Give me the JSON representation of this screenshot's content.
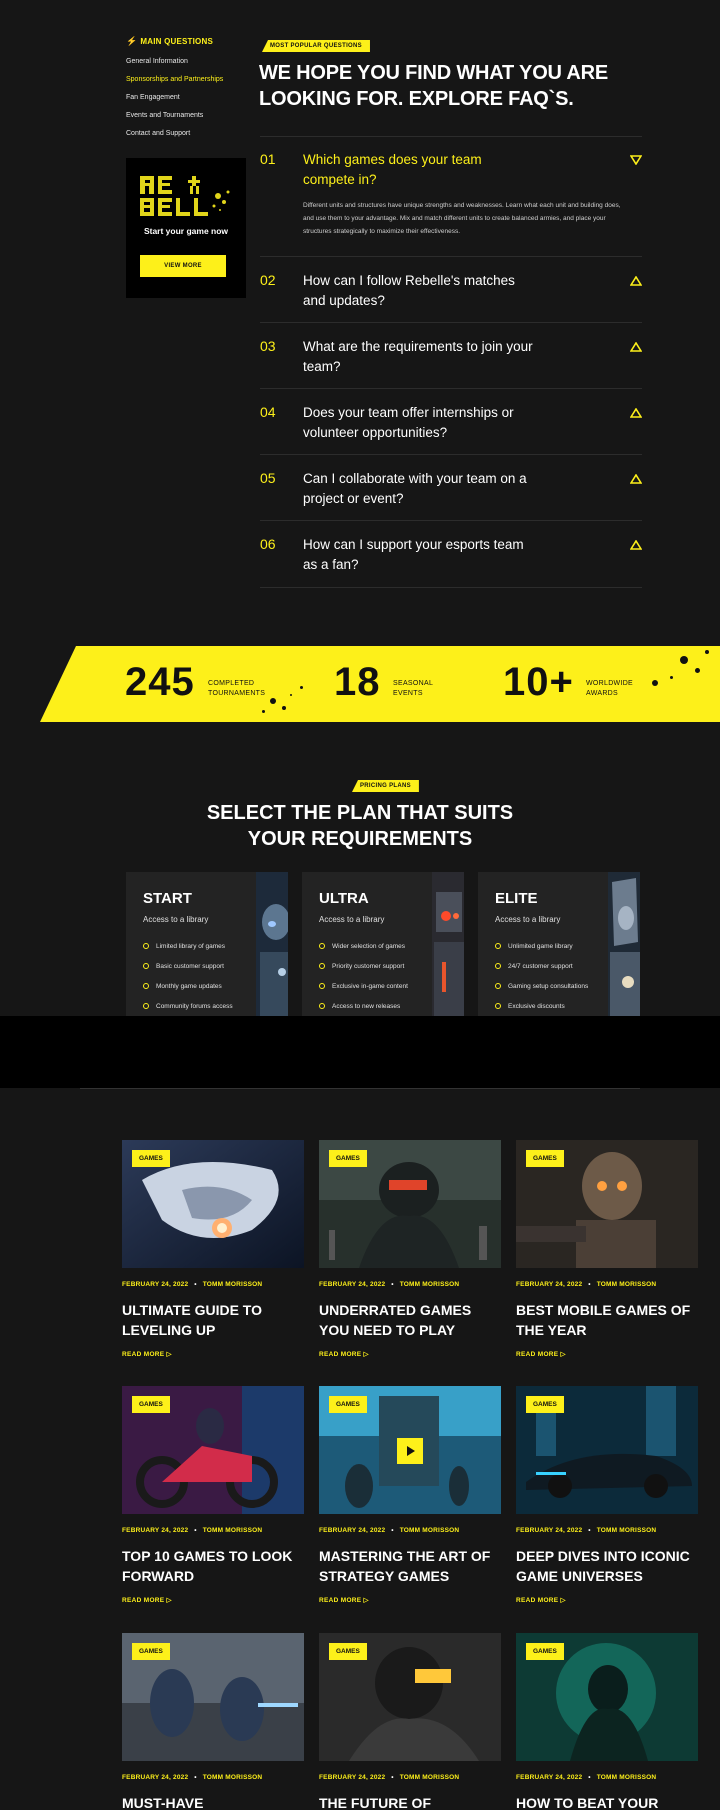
{
  "faq_nav": {
    "title": "MAIN QUESTIONS",
    "items": [
      {
        "label": "General Information",
        "active": false
      },
      {
        "label": "Sponsorships and Partnerships",
        "active": true
      },
      {
        "label": "Fan Engagement",
        "active": false
      },
      {
        "label": "Events and Tournaments",
        "active": false
      },
      {
        "label": "Contact and Support",
        "active": false
      }
    ],
    "promo": {
      "logo_text": "RE BELL",
      "text": "Start your game now",
      "button": "VIEW MORE"
    }
  },
  "faq": {
    "tag": "MOST POPULAR QUESTIONS",
    "heading": "WE HOPE YOU FIND WHAT YOU ARE LOOKING FOR. EXPLORE FAQ`S.",
    "items": [
      {
        "num": "01",
        "question": "Which games does your team compete in?",
        "open": true,
        "answer": "Different units and structures have unique strengths and weaknesses. Learn what each unit and building does, and use them to your advantage. Mix and match different units to create balanced armies, and place your structures strategically to maximize their effectiveness."
      },
      {
        "num": "02",
        "question": "How can I follow Rebelle's matches and updates?",
        "open": false
      },
      {
        "num": "03",
        "question": "What are the requirements to join your team?",
        "open": false
      },
      {
        "num": "04",
        "question": "Does your team offer internships or volunteer opportunities?",
        "open": false
      },
      {
        "num": "05",
        "question": "Can I collaborate with your team on a project or event?",
        "open": false
      },
      {
        "num": "06",
        "question": "How can I support your esports team as a fan?",
        "open": false
      }
    ]
  },
  "stats": [
    {
      "value": "245",
      "label_1": "COMPLETED",
      "label_2": "TOURNAMENTS"
    },
    {
      "value": "18",
      "label_1": "SEASONAL",
      "label_2": "EVENTS"
    },
    {
      "value": "10+",
      "label_1": "WORLDWIDE",
      "label_2": "AWARDS"
    }
  ],
  "pricing": {
    "tag": "PRICING PLANS",
    "heading_1": "SELECT THE PLAN THAT SUITS",
    "heading_2": "YOUR REQUIREMENTS",
    "plans": [
      {
        "name": "START",
        "subtitle": "Access to a library",
        "features": [
          "Limited library of games",
          "Basic customer support",
          "Monthly game updates",
          "Community forums access"
        ]
      },
      {
        "name": "ULTRA",
        "subtitle": "Access to a library",
        "features": [
          "Wider selection of games",
          "Priority customer support",
          "Exclusive in-game content",
          "Access to new releases"
        ]
      },
      {
        "name": "ELITE",
        "subtitle": "Access to a library",
        "features": [
          "Unlimited game library",
          "24/7 customer support",
          "Gaming setup consultations",
          "Exclusive discounts"
        ]
      }
    ]
  },
  "blog": {
    "posts": [
      {
        "badge": "GAMES",
        "date": "FEBRUARY 24, 2022",
        "author": "TOMM MORISSON",
        "title": "ULTIMATE GUIDE TO LEVELING UP",
        "read_more": "READ MORE ▷"
      },
      {
        "badge": "GAMES",
        "date": "FEBRUARY 24, 2022",
        "author": "TOMM MORISSON",
        "title": "UNDERRATED GAMES YOU NEED TO PLAY",
        "read_more": "READ MORE ▷"
      },
      {
        "badge": "GAMES",
        "date": "FEBRUARY 24, 2022",
        "author": "TOMM MORISSON",
        "title": "BEST MOBILE GAMES OF THE YEAR",
        "read_more": "READ MORE ▷"
      },
      {
        "badge": "GAMES",
        "date": "FEBRUARY 24, 2022",
        "author": "TOMM MORISSON",
        "title": "TOP 10 GAMES TO LOOK FORWARD",
        "read_more": "READ MORE ▷"
      },
      {
        "badge": "GAMES",
        "date": "FEBRUARY 24, 2022",
        "author": "TOMM MORISSON",
        "title": "MASTERING THE ART OF STRATEGY GAMES",
        "read_more": "READ MORE ▷"
      },
      {
        "badge": "GAMES",
        "date": "FEBRUARY 24, 2022",
        "author": "TOMM MORISSON",
        "title": "DEEP DIVES INTO ICONIC GAME UNIVERSES",
        "read_more": "READ MORE ▷"
      },
      {
        "badge": "GAMES",
        "date": "FEBRUARY 24, 2022",
        "author": "TOMM MORISSON",
        "title": "MUST-HAVE ACCESSORIES",
        "read_more": ""
      },
      {
        "badge": "GAMES",
        "date": "FEBRUARY 24, 2022",
        "author": "TOMM MORISSON",
        "title": "THE FUTURE OF",
        "read_more": ""
      },
      {
        "badge": "GAMES",
        "date": "FEBRUARY 24, 2022",
        "author": "TOMM MORISSON",
        "title": "HOW TO BEAT YOUR",
        "read_more": ""
      }
    ]
  },
  "colors": {
    "accent": "#fdf01a",
    "background": "#161616",
    "card": "#232323"
  }
}
